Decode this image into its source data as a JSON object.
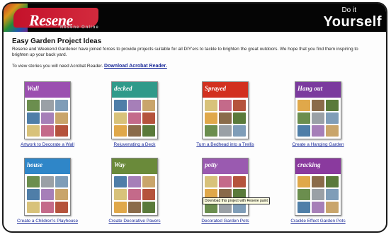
{
  "header": {
    "logo_text": "Resene",
    "logo_sub": "Resene Online",
    "tagline_small": "Do it",
    "tagline_big": "Yourself"
  },
  "page": {
    "title": "Easy Garden Project Ideas",
    "intro": "Resene and Weekend Gardener have joined forces to provide projects suitable for all DIY'ers to tackle to brighten the great outdoors. We hope that you find them inspiring to brighten up your back yard.",
    "reader_text": "To view stories you will need Acrobat Reader.",
    "reader_link": "Download Acrobat Reader."
  },
  "projects": [
    {
      "caption": "Artwork to Decorate a Wall",
      "cover_title": "Wall",
      "accent": "#9b4fb0"
    },
    {
      "caption": "Rejuvenating a Deck",
      "cover_title": "decked",
      "accent": "#2f9a8a"
    },
    {
      "caption": "Turn a Bedhead into a Trellis",
      "cover_title": "Sprayed",
      "accent": "#d2301f"
    },
    {
      "caption": "Create a Hanging Garden",
      "cover_title": "Hang out",
      "accent": "#7b3a9e"
    },
    {
      "caption": "Create a Children's Playhouse",
      "cover_title": "house",
      "accent": "#2f86c8"
    },
    {
      "caption": "Create Decorative Pavers",
      "cover_title": "Way",
      "accent": "#6a8a3a"
    },
    {
      "caption": "Decorated Garden Pots",
      "cover_title": "potty",
      "accent": "#9a5ab0"
    },
    {
      "caption": "Crackle Effect Garden Pots",
      "cover_title": "cracking",
      "accent": "#8a3a9e"
    }
  ],
  "tooltip": "Download this project with Resene paint"
}
